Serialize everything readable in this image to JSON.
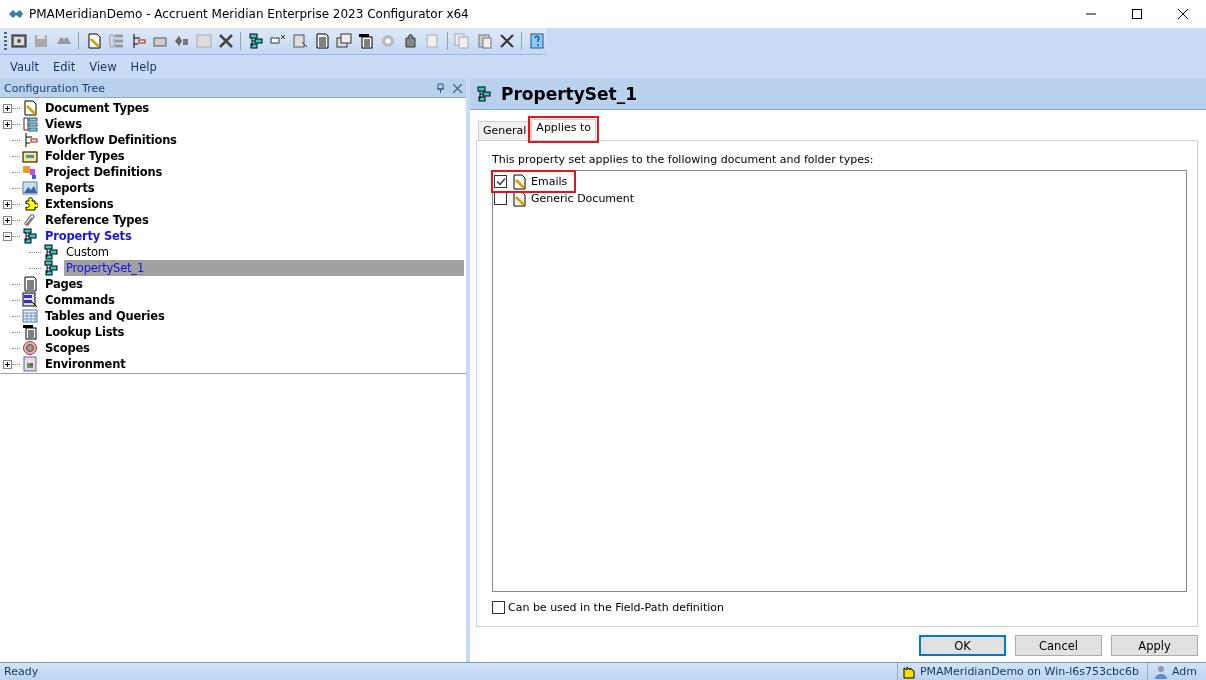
{
  "window": {
    "title": "PMAMeridianDemo - Accruent Meridian Enterprise 2023 Configurator x64"
  },
  "menu": [
    "Vault",
    "Edit",
    "View",
    "Help"
  ],
  "tree_panel": {
    "title": "Configuration Tree",
    "items": [
      {
        "label": "Document Types",
        "expandable": true,
        "expanded": false,
        "active": false,
        "selected": false
      },
      {
        "label": "Views",
        "expandable": true,
        "expanded": false,
        "active": false,
        "selected": false
      },
      {
        "label": "Workflow Definitions",
        "expandable": false,
        "active": false,
        "selected": false
      },
      {
        "label": "Folder Types",
        "expandable": false,
        "active": false,
        "selected": false
      },
      {
        "label": "Project Definitions",
        "expandable": false,
        "active": false,
        "selected": false
      },
      {
        "label": "Reports",
        "expandable": false,
        "active": false,
        "selected": false
      },
      {
        "label": "Extensions",
        "expandable": true,
        "expanded": false,
        "active": false,
        "selected": false
      },
      {
        "label": "Reference Types",
        "expandable": true,
        "expanded": false,
        "active": false,
        "selected": false
      },
      {
        "label": "Property Sets",
        "expandable": true,
        "expanded": true,
        "active": true,
        "selected": false,
        "children": [
          {
            "label": "Custom",
            "selected": false
          },
          {
            "label": "PropertySet_1",
            "selected": true
          }
        ]
      },
      {
        "label": "Pages",
        "expandable": false,
        "active": false,
        "selected": false
      },
      {
        "label": "Commands",
        "expandable": false,
        "active": false,
        "selected": false
      },
      {
        "label": "Tables and Queries",
        "expandable": false,
        "active": false,
        "selected": false
      },
      {
        "label": "Lookup Lists",
        "expandable": false,
        "active": false,
        "selected": false
      },
      {
        "label": "Scopes",
        "expandable": false,
        "active": false,
        "selected": false
      },
      {
        "label": "Environment",
        "expandable": true,
        "expanded": false,
        "active": false,
        "selected": false
      }
    ]
  },
  "detail": {
    "title": "PropertySet_1",
    "tabs": [
      {
        "label": "General",
        "selected": false,
        "annotated": false
      },
      {
        "label": "Applies to",
        "selected": true,
        "annotated": true
      }
    ],
    "description": "This property set applies to the following document and folder types:",
    "types": [
      {
        "label": "Emails",
        "checked": true,
        "annotated": true
      },
      {
        "label": "Generic Document",
        "checked": false,
        "annotated": false
      }
    ],
    "field_path": {
      "label": "Can be used in the Field-Path definition",
      "checked": false
    },
    "buttons": [
      {
        "label": "OK",
        "default": true
      },
      {
        "label": "Cancel",
        "default": false
      },
      {
        "label": "Apply",
        "default": false
      }
    ]
  },
  "status_bar": {
    "left": "Ready",
    "connection": "PMAMeridianDemo on Win-l6s753cbc6b",
    "user": "Adm"
  }
}
